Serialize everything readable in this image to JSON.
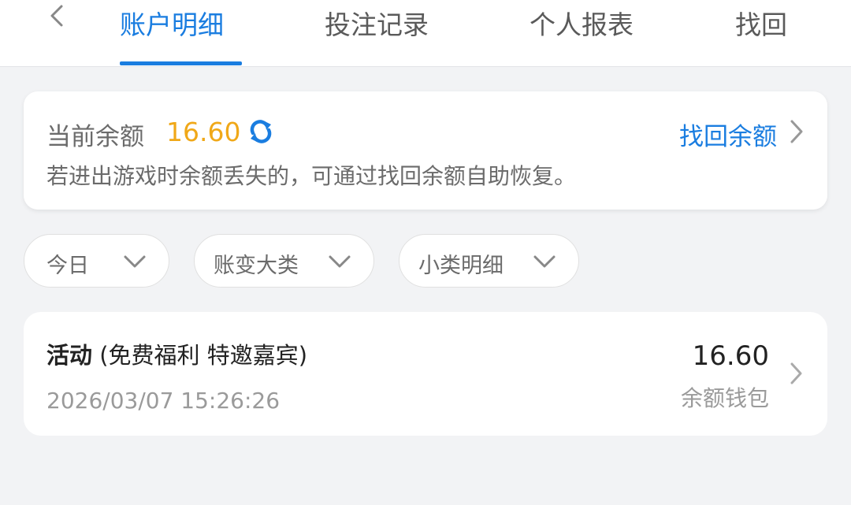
{
  "nav": {
    "back_icon": "chevron-left-icon",
    "tabs": [
      {
        "label": "账户明细",
        "active": true
      },
      {
        "label": "投注记录",
        "active": false
      },
      {
        "label": "个人报表",
        "active": false
      },
      {
        "label": "找回",
        "active": false
      }
    ]
  },
  "balance": {
    "label": "当前余额",
    "value": "16.60",
    "refresh_icon": "refresh-icon",
    "recover_label": "找回余额",
    "hint": "若进出游戏时余额丢失的，可通过找回余额自助恢复。"
  },
  "filters": [
    {
      "label": "今日"
    },
    {
      "label": "账变大类"
    },
    {
      "label": "小类明细"
    }
  ],
  "records": [
    {
      "category": "活动",
      "detail": "(免费福利  特邀嘉宾)",
      "timestamp": "2026/03/07 15:26:26",
      "amount": "16.60",
      "wallet": "余额钱包"
    }
  ],
  "colors": {
    "accent": "#1a7de0",
    "balance": "#f0a818",
    "background": "#f2f3f5"
  }
}
